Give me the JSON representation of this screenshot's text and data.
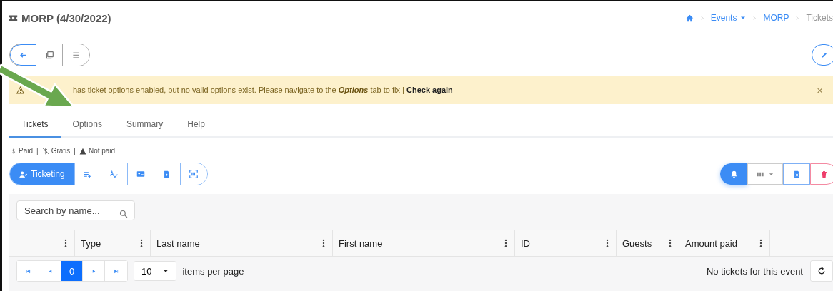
{
  "header": {
    "title": "MORP (4/30/2022)",
    "breadcrumbs": [
      {
        "label": "Events",
        "dropdown": true,
        "current": false
      },
      {
        "label": "MORP",
        "dropdown": false,
        "current": false
      },
      {
        "label": "Tickets",
        "dropdown": false,
        "current": true
      }
    ]
  },
  "warning": {
    "text": "has ticket options enabled, but no valid options exist. Please navigate to the *Options* tab to fix | **Check again**",
    "close": "×"
  },
  "tabs": [
    {
      "label": "Tickets",
      "selected": true
    },
    {
      "label": "Options",
      "selected": false
    },
    {
      "label": "Summary",
      "selected": false
    },
    {
      "label": "Help",
      "selected": false
    }
  ],
  "legend": {
    "separator": "|",
    "items": [
      {
        "kind": "paid",
        "label": "Paid"
      },
      {
        "kind": "gratis",
        "label": "Gratis"
      },
      {
        "kind": "unpaid",
        "label": "Not paid"
      }
    ]
  },
  "action_bar": {
    "primary": {
      "label": "Ticketing",
      "selected": true
    }
  },
  "search": {
    "placeholder": "Search by name..."
  },
  "table": {
    "columns": [
      {
        "menu": true
      },
      {
        "label": "Type",
        "menu": true
      },
      {
        "label": "Last name",
        "menu": true
      },
      {
        "label": "First name",
        "menu": true
      },
      {
        "label": "ID",
        "menu": true
      },
      {
        "label": "Guests",
        "menu": true
      },
      {
        "label": "Amount paid",
        "menu": true
      }
    ]
  },
  "pagination": {
    "page": "0",
    "page_size": "10",
    "page_size_label": "items per page",
    "empty_message": "No tickets for this event"
  }
}
